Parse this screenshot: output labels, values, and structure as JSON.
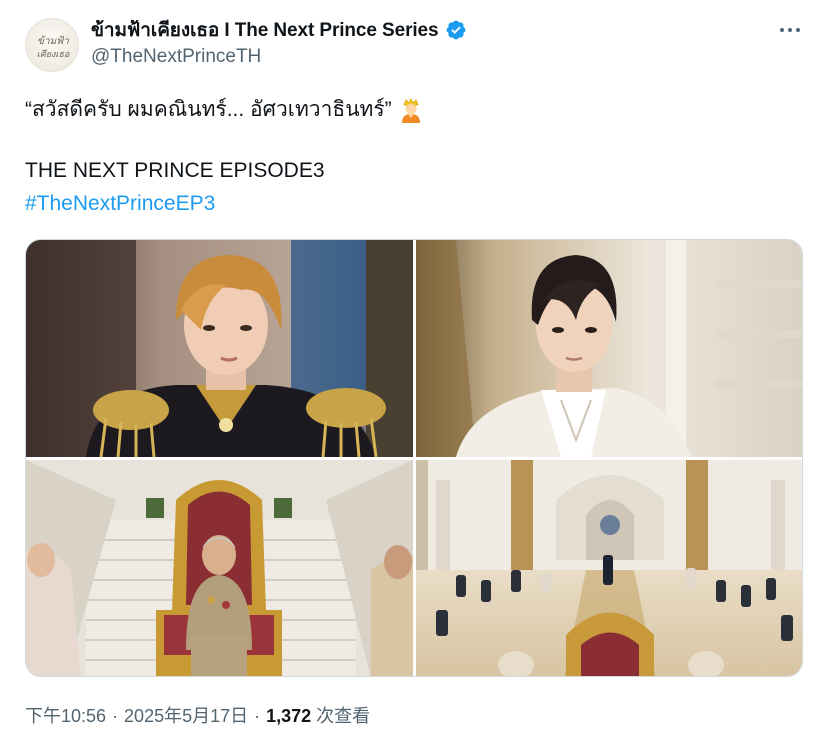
{
  "header": {
    "display_name": "ข้ามฟ้าเคียงเธอ I The Next Prince Series",
    "handle": "@TheNextPrinceTH",
    "avatar_text_line1": "ข้ามฟ้า",
    "avatar_text_line2": "เคียงเธอ",
    "verified_color": "#1d9bf0"
  },
  "tweet": {
    "line1": "“สวัสดีครับ ผมคณินทร์... อัศวเทวาธินทร์”",
    "line1_emoji": "person-with-crown-emoji",
    "line2": "THE NEXT PRINCE EPISODE3",
    "hashtag": "#TheNextPrinceEP3"
  },
  "media": {
    "photos": [
      {
        "subject": "prince in gold-embroidered uniform"
      },
      {
        "subject": "man in white suit"
      },
      {
        "subject": "older man on red throne"
      },
      {
        "subject": "palace hall ceremony"
      }
    ]
  },
  "meta": {
    "time": "下午10:56",
    "separator": "·",
    "date": "2025年5月17日",
    "views_count": "1,372",
    "views_label": " 次查看"
  },
  "colors": {
    "accent": "#1d9bf0",
    "secondary_text": "#536471",
    "primary_text": "#0f1419",
    "border": "#cfd9de"
  }
}
